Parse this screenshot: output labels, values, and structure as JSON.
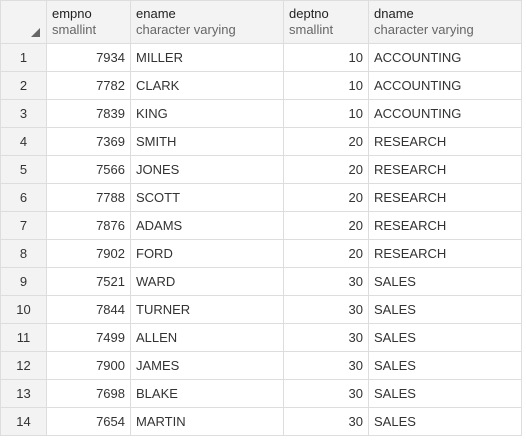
{
  "columns": [
    {
      "name": "empno",
      "type": "smallint"
    },
    {
      "name": "ename",
      "type": "character varying"
    },
    {
      "name": "deptno",
      "type": "smallint"
    },
    {
      "name": "dname",
      "type": "character varying"
    }
  ],
  "rows": [
    {
      "num": "1",
      "empno": "7934",
      "ename": "MILLER",
      "deptno": "10",
      "dname": "ACCOUNTING"
    },
    {
      "num": "2",
      "empno": "7782",
      "ename": "CLARK",
      "deptno": "10",
      "dname": "ACCOUNTING"
    },
    {
      "num": "3",
      "empno": "7839",
      "ename": "KING",
      "deptno": "10",
      "dname": "ACCOUNTING"
    },
    {
      "num": "4",
      "empno": "7369",
      "ename": "SMITH",
      "deptno": "20",
      "dname": "RESEARCH"
    },
    {
      "num": "5",
      "empno": "7566",
      "ename": "JONES",
      "deptno": "20",
      "dname": "RESEARCH"
    },
    {
      "num": "6",
      "empno": "7788",
      "ename": "SCOTT",
      "deptno": "20",
      "dname": "RESEARCH"
    },
    {
      "num": "7",
      "empno": "7876",
      "ename": "ADAMS",
      "deptno": "20",
      "dname": "RESEARCH"
    },
    {
      "num": "8",
      "empno": "7902",
      "ename": "FORD",
      "deptno": "20",
      "dname": "RESEARCH"
    },
    {
      "num": "9",
      "empno": "7521",
      "ename": "WARD",
      "deptno": "30",
      "dname": "SALES"
    },
    {
      "num": "10",
      "empno": "7844",
      "ename": "TURNER",
      "deptno": "30",
      "dname": "SALES"
    },
    {
      "num": "11",
      "empno": "7499",
      "ename": "ALLEN",
      "deptno": "30",
      "dname": "SALES"
    },
    {
      "num": "12",
      "empno": "7900",
      "ename": "JAMES",
      "deptno": "30",
      "dname": "SALES"
    },
    {
      "num": "13",
      "empno": "7698",
      "ename": "BLAKE",
      "deptno": "30",
      "dname": "SALES"
    },
    {
      "num": "14",
      "empno": "7654",
      "ename": "MARTIN",
      "deptno": "30",
      "dname": "SALES"
    }
  ],
  "icons": {
    "corner": "select-all-corner-icon"
  },
  "colors": {
    "header_bg": "#f3f3f3",
    "grid_line": "#dddddd",
    "text": "#333333",
    "type_text": "#666666"
  }
}
